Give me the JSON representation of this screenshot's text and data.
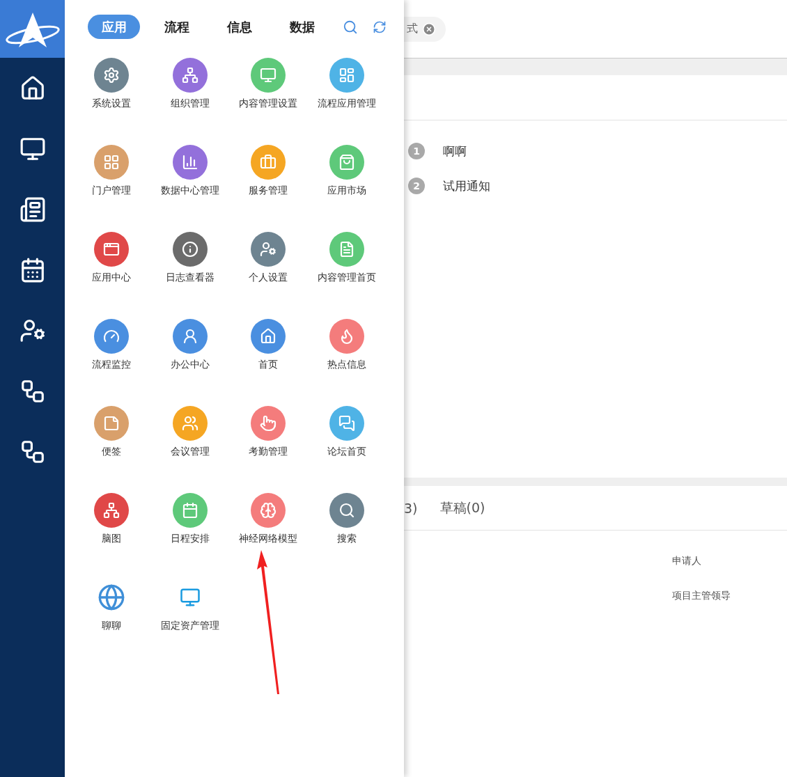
{
  "menu_tabs": [
    {
      "label": "应用",
      "selected": true
    },
    {
      "label": "流程",
      "selected": false
    },
    {
      "label": "信息",
      "selected": false
    },
    {
      "label": "数据",
      "selected": false
    }
  ],
  "apps": [
    {
      "label": "系统设置",
      "kind": "circle",
      "color": "#6e8491"
    },
    {
      "label": "组织管理",
      "kind": "circle",
      "color": "#9370db"
    },
    {
      "label": "内容管理设置",
      "kind": "circle",
      "color": "#5ec97a"
    },
    {
      "label": "流程应用管理",
      "kind": "circle",
      "color": "#4fb3e6"
    },
    {
      "label": "门户管理",
      "kind": "circle",
      "color": "#d9a06b"
    },
    {
      "label": "数据中心管理",
      "kind": "circle",
      "color": "#9370db"
    },
    {
      "label": "服务管理",
      "kind": "circle",
      "color": "#f5a623"
    },
    {
      "label": "应用市场",
      "kind": "circle",
      "color": "#5ec97a"
    },
    {
      "label": "应用中心",
      "kind": "circle",
      "color": "#e04848"
    },
    {
      "label": "日志查看器",
      "kind": "circle",
      "color": "#6b6b6b"
    },
    {
      "label": "个人设置",
      "kind": "circle",
      "color": "#6e8491"
    },
    {
      "label": "内容管理首页",
      "kind": "circle",
      "color": "#5ec97a"
    },
    {
      "label": "流程监控",
      "kind": "circle",
      "color": "#4a8fe0"
    },
    {
      "label": "办公中心",
      "kind": "circle",
      "color": "#4a8fe0"
    },
    {
      "label": "首页",
      "kind": "circle",
      "color": "#4a8fe0"
    },
    {
      "label": "热点信息",
      "kind": "circle",
      "color": "#f47c7c"
    },
    {
      "label": "便签",
      "kind": "circle",
      "color": "#d9a06b"
    },
    {
      "label": "会议管理",
      "kind": "circle",
      "color": "#f5a623"
    },
    {
      "label": "考勤管理",
      "kind": "circle",
      "color": "#f47c7c"
    },
    {
      "label": "论坛首页",
      "kind": "circle",
      "color": "#4fb3e6"
    },
    {
      "label": "脑图",
      "kind": "circle",
      "color": "#e04848"
    },
    {
      "label": "日程安排",
      "kind": "circle",
      "color": "#5ec97a"
    },
    {
      "label": "神经网络模型",
      "kind": "circle",
      "color": "#f47c7c"
    },
    {
      "label": "搜索",
      "kind": "circle",
      "color": "#6e8491"
    },
    {
      "label": "聊聊",
      "kind": "plain",
      "color": "#3f8fd8"
    },
    {
      "label": "固定资产管理",
      "kind": "plain",
      "color": "#1a9be0"
    }
  ],
  "open_tab": {
    "label": "式"
  },
  "notices": [
    {
      "number": "1",
      "title": "啊啊"
    },
    {
      "number": "2",
      "title": "试用通知"
    }
  ],
  "flow_tabs": [
    {
      "label": "3)"
    },
    {
      "label": "草稿(0)"
    }
  ],
  "fields": [
    "申请人",
    "项目主管领导"
  ]
}
